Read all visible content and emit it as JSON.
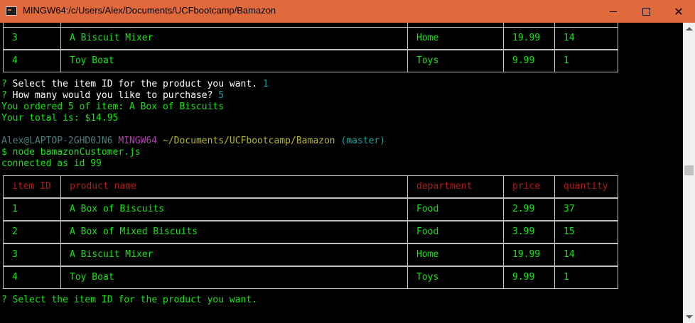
{
  "window": {
    "title": "MINGW64:/c/Users/Alex/Documents/UCFbootcamp/Bamazon"
  },
  "top_table_rows": [
    {
      "id": "3",
      "name": "A Biscuit Mixer",
      "department": "Home",
      "price": "19.99",
      "quantity": "14"
    },
    {
      "id": "4",
      "name": "Toy Boat",
      "department": "Toys",
      "price": "9.99",
      "quantity": "1"
    }
  ],
  "prompt1": {
    "mark": "?",
    "text": " Select the item ID for the product you want. ",
    "answer": "1"
  },
  "prompt2": {
    "mark": "?",
    "text": " How many would you like to purchase? ",
    "answer": "5"
  },
  "order_msg": "You ordered 5 of item: A Box of Biscuits",
  "total_msg": "Your total is: $14.95",
  "ps1": {
    "user_host": "Alex@LAPTOP-2GHD0JN6",
    "env": "MINGW64",
    "path": "~/Documents/UCFbootcamp/Bamazon",
    "branch": "(master)"
  },
  "command": "$ node bamazonCustomer.js",
  "connected_msg": "connected as id 99",
  "table": {
    "headers": [
      "item ID",
      "product name",
      "department",
      "price",
      "quantity"
    ],
    "rows": [
      {
        "id": "1",
        "name": "A Box of Biscuits",
        "department": "Food",
        "price": "2.99",
        "quantity": "37"
      },
      {
        "id": "2",
        "name": "A Box of Mixed Biscuits",
        "department": "Food",
        "price": "3.99",
        "quantity": "15"
      },
      {
        "id": "3",
        "name": "A Biscuit Mixer",
        "department": "Home",
        "price": "19.99",
        "quantity": "14"
      },
      {
        "id": "4",
        "name": "Toy Boat",
        "department": "Toys",
        "price": "9.99",
        "quantity": "1"
      }
    ]
  },
  "prompt3": {
    "mark": "?",
    "text": " Select the item ID for the product you want."
  }
}
